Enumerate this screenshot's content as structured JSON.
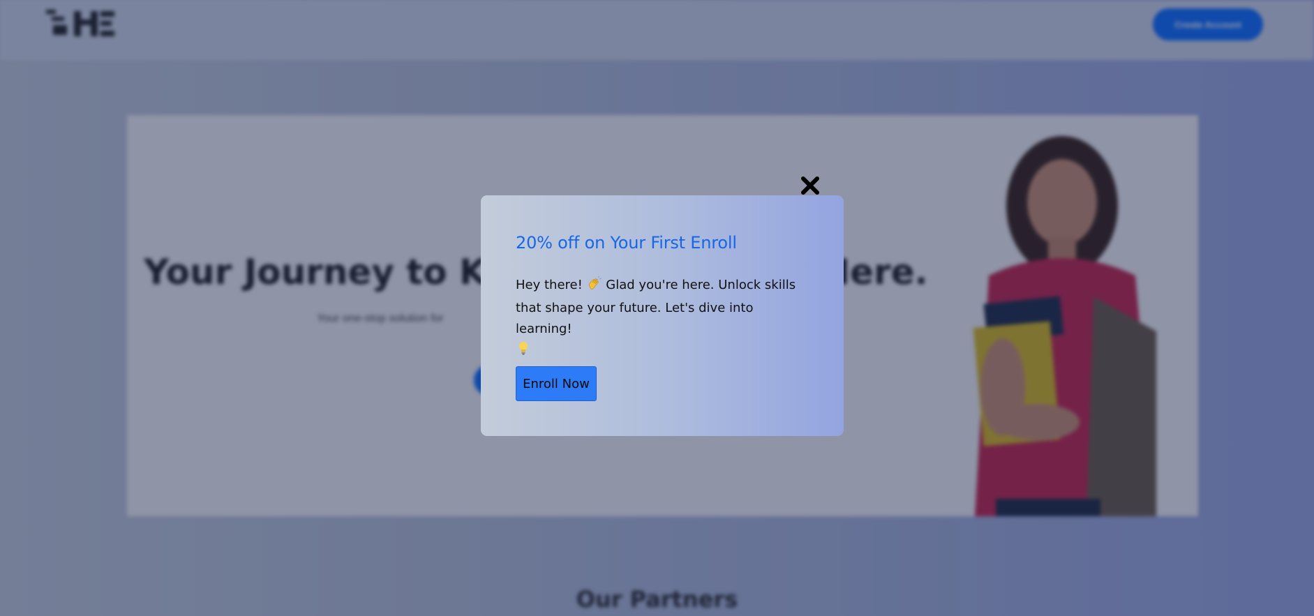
{
  "header": {
    "create_account_label": "Create Account"
  },
  "hero": {
    "title": "Your Journey to Knowledge Starts Here.",
    "subtitle": "Your one-stop solution for"
  },
  "partners": {
    "title": "Our Partners"
  },
  "modal": {
    "title": "20% off on Your First Enroll",
    "body_part1": "Hey there!",
    "body_part2": "Glad you're here. Unlock skills that shape your future. Let's dive into learning!",
    "enroll_label": "Enroll Now",
    "wave_icon": "waving-hand-icon",
    "bulb_icon": "lightbulb-icon",
    "close_icon": "close-icon"
  },
  "colors": {
    "accent": "#0d6efd",
    "modal_title": "#1766e6",
    "enroll_button": "#2e7bf7"
  }
}
